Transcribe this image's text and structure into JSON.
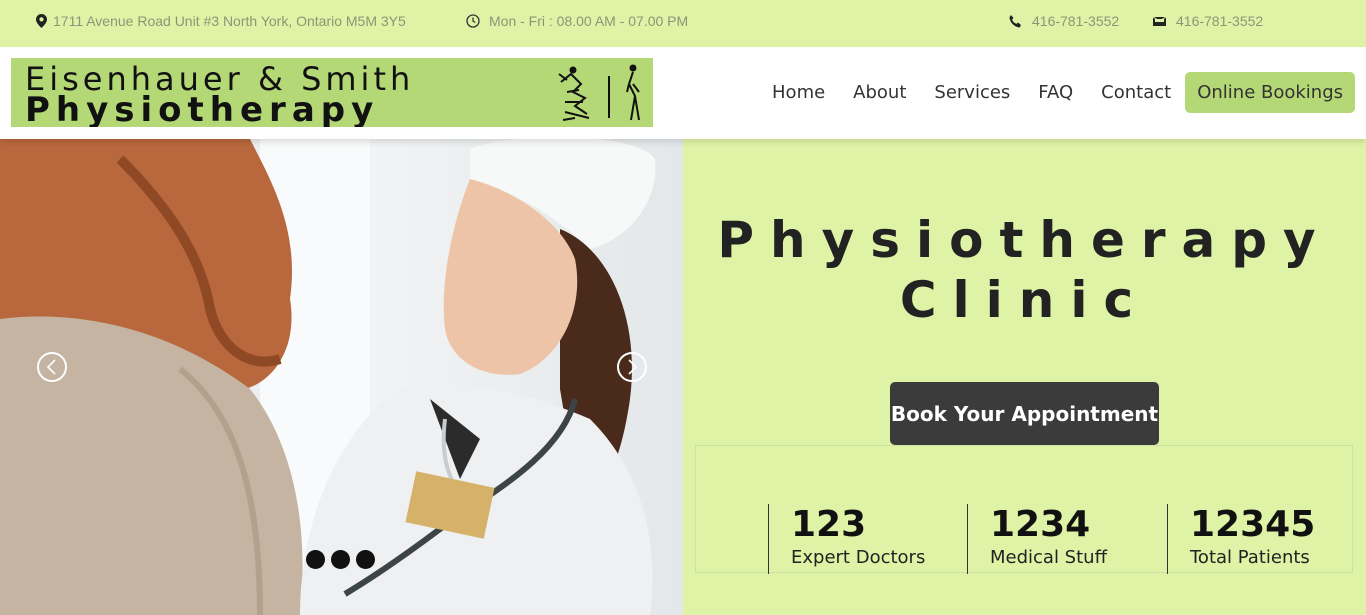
{
  "topbar": {
    "address": "1711 Avenue Road Unit #3 North York, Ontario M5M 3Y5",
    "hours": "Mon - Fri : 08.00 AM - 07.00 PM",
    "phone": "416-781-3552",
    "fax": "416-781-3552"
  },
  "logo": {
    "line1": "Eisenhauer & Smith",
    "line2": "Physiotherapy"
  },
  "nav": {
    "items": [
      "Home",
      "About",
      "Services",
      "FAQ",
      "Contact"
    ],
    "booking": "Online Bookings"
  },
  "hero": {
    "title_line1": "Physiotherapy",
    "title_line2": "Clinic",
    "cta": "Book Your Appointment",
    "stats": [
      {
        "value": "123",
        "label": "Expert Doctors"
      },
      {
        "value": "1234",
        "label": "Medical Stuff"
      },
      {
        "value": "12345",
        "label": "Total Patients"
      }
    ]
  },
  "colors": {
    "accent_light": "#dff3a6",
    "accent": "#b5d877",
    "button_dark": "#3b3b3b"
  },
  "icons": [
    "map-marker-icon",
    "clock-icon",
    "phone-icon",
    "fax-icon",
    "chevron-left-icon",
    "chevron-right-icon"
  ]
}
